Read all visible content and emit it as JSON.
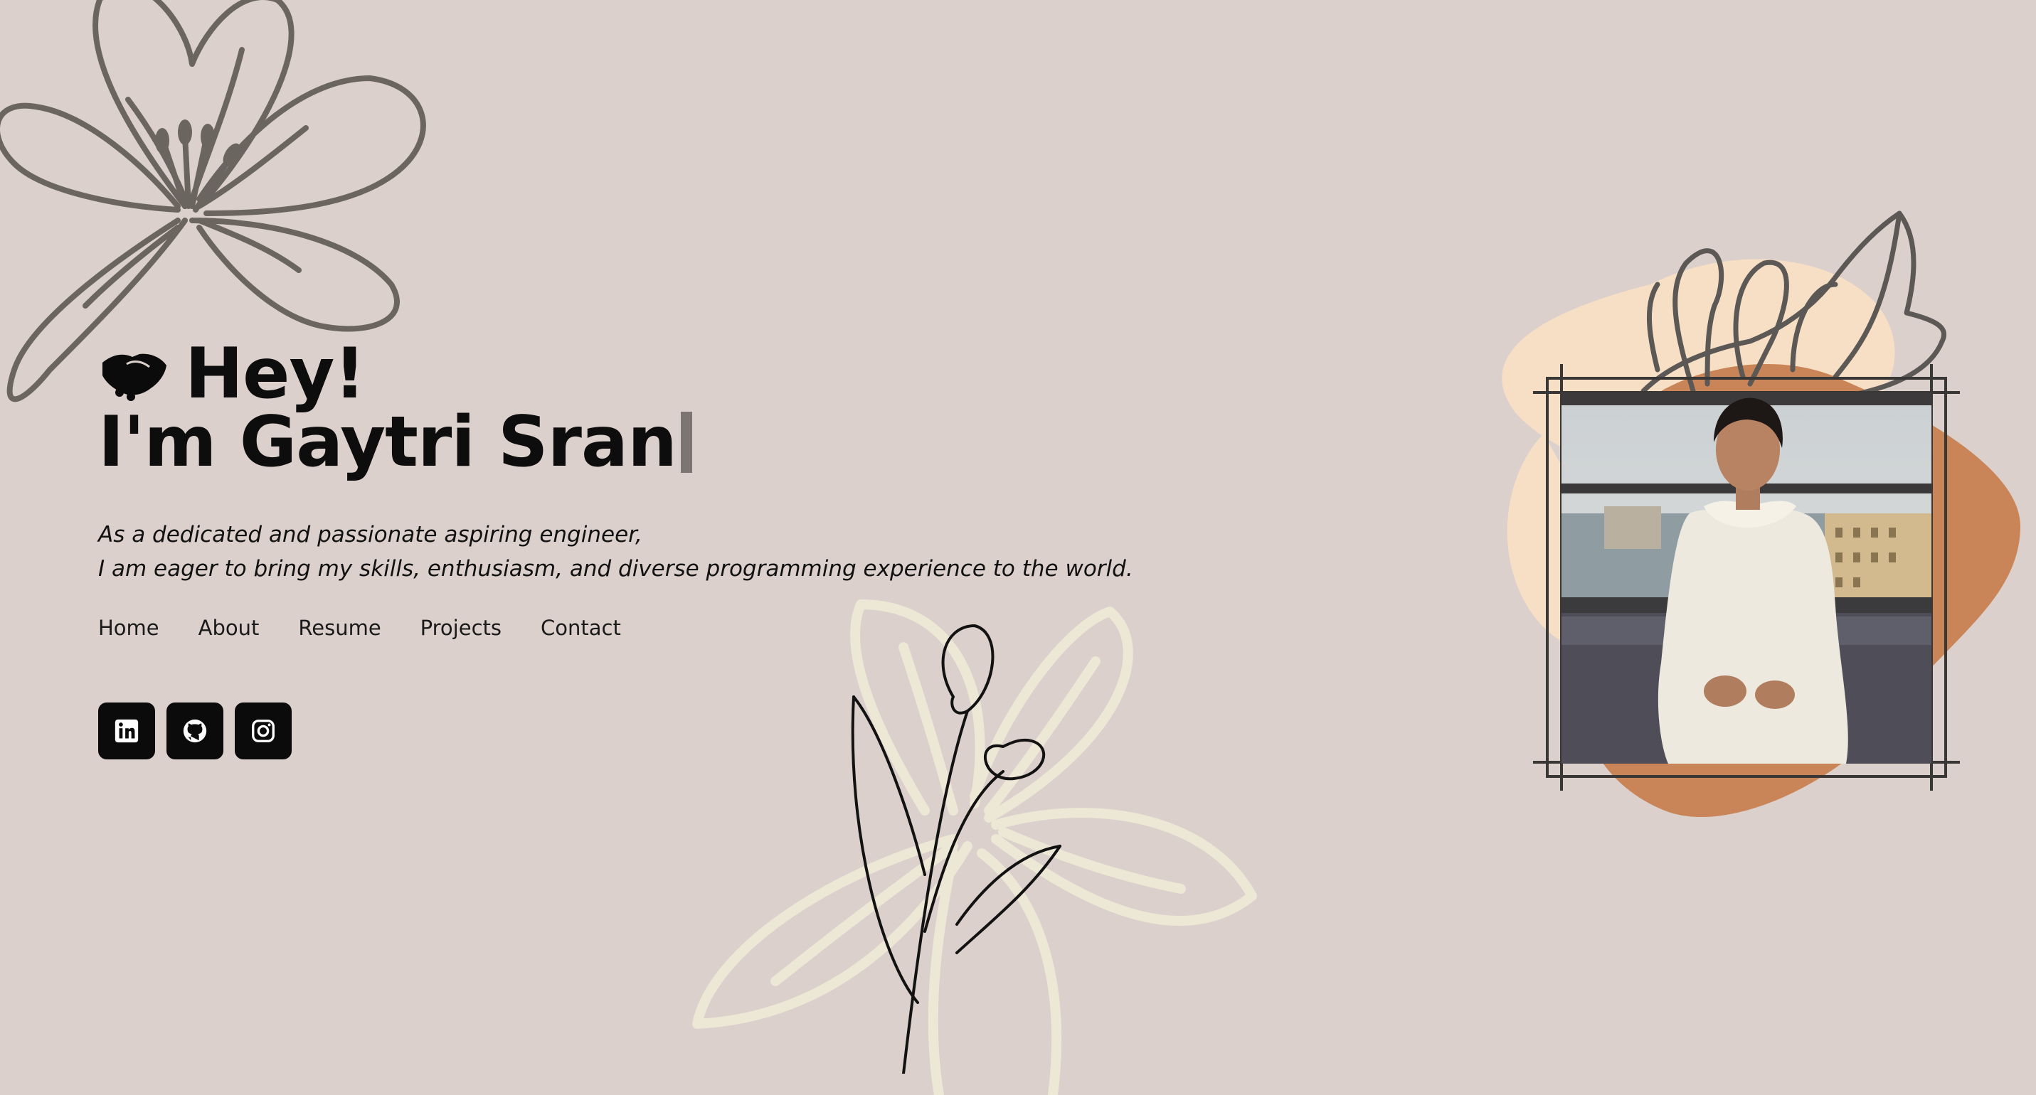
{
  "hero": {
    "greeting_icon": "handshake-icon",
    "greeting": "Hey!",
    "name_line": "I'm Gaytri Sran"
  },
  "intro": {
    "line1": "As a dedicated and passionate aspiring engineer,",
    "line2": "I am eager to bring my skills, enthusiasm, and diverse programming experience to the world."
  },
  "nav": {
    "items": [
      {
        "label": "Home"
      },
      {
        "label": "About"
      },
      {
        "label": "Resume"
      },
      {
        "label": "Projects"
      },
      {
        "label": "Contact"
      }
    ]
  },
  "socials": [
    {
      "icon": "linkedin-icon"
    },
    {
      "icon": "github-icon"
    },
    {
      "icon": "instagram-icon"
    }
  ],
  "colors": {
    "background": "#dbd0cb",
    "text": "#0d0d0d",
    "flower_outline": "#6b6560",
    "flower_light": "#ede7d6",
    "blob_peach": "#f7dfc5",
    "blob_orange": "#c98557",
    "cursor": "#7c7571"
  }
}
